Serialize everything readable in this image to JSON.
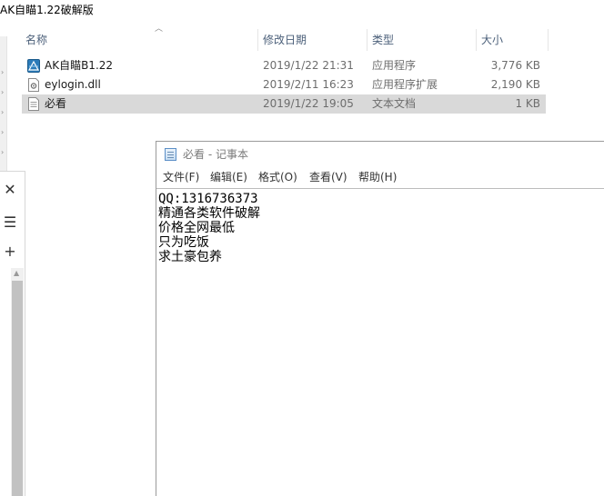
{
  "explorer": {
    "title": "AK自瞄1.22破解版",
    "columns": {
      "name": "名称",
      "date": "修改日期",
      "type": "类型",
      "size": "大小"
    },
    "files": [
      {
        "name": "AK自瞄B1.22",
        "date": "2019/1/22 21:31",
        "type": "应用程序",
        "size": "3,776 KB",
        "icon": "app-icon"
      },
      {
        "name": "eylogin.dll",
        "date": "2019/2/11 16:23",
        "type": "应用程序扩展",
        "size": "2,190 KB",
        "icon": "dll-icon"
      },
      {
        "name": "必看",
        "date": "2019/1/22 19:05",
        "type": "文本文档",
        "size": "1 KB",
        "icon": "text-file-icon"
      }
    ]
  },
  "side_panel": {
    "close_glyph": "✕",
    "menu_glyph": "☰",
    "add_glyph": "+"
  },
  "notepad": {
    "title": "必看 - 记事本",
    "menu": [
      "文件(F)",
      "编辑(E)",
      "格式(O)",
      "查看(V)",
      "帮助(H)"
    ],
    "lines": [
      "QQ:1316736373",
      "精通各类软件破解",
      "价格全网最低",
      "只为吃饭",
      "求土豪包养"
    ]
  }
}
